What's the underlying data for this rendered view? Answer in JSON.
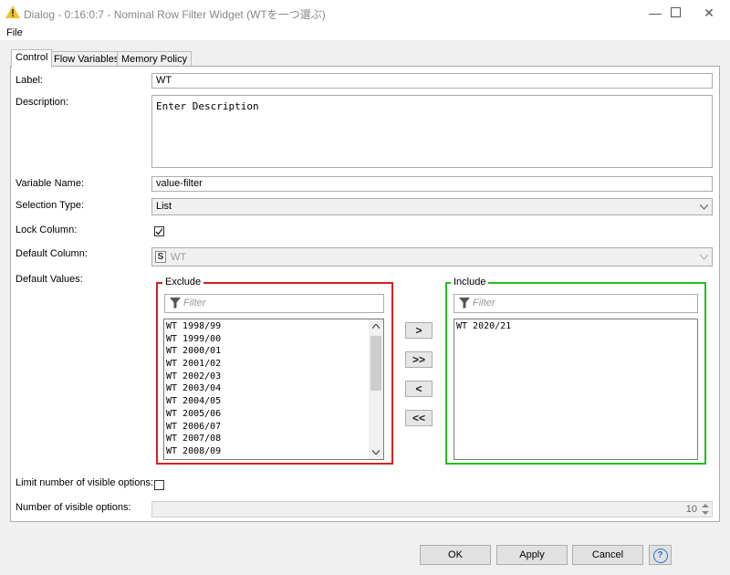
{
  "window": {
    "title": "Dialog - 0:16:0:7 - Nominal Row Filter Widget (WTを一つ選ぶ)"
  },
  "menu": {
    "file": "File"
  },
  "tabs": [
    {
      "label": "Control"
    },
    {
      "label": "Flow Variables"
    },
    {
      "label": "Memory Policy"
    }
  ],
  "form": {
    "label_label": "Label:",
    "label_value": "WT",
    "description_label": "Description:",
    "description_value": "Enter Description",
    "variable_name_label": "Variable Name:",
    "variable_name_value": "value-filter",
    "selection_type_label": "Selection Type:",
    "selection_type_value": "List",
    "lock_column_label": "Lock Column:",
    "lock_column_checked": true,
    "default_column_label": "Default Column:",
    "default_column_type": "S",
    "default_column_value": "WT",
    "default_values_label": "Default Values:",
    "limit_visible_label": "Limit number of visible options:",
    "limit_visible_checked": false,
    "num_visible_label": "Number of visible options:",
    "num_visible_value": "10"
  },
  "exclude": {
    "title": "Exclude",
    "filter_placeholder": "Filter",
    "items": [
      "WT 1998/99",
      "WT 1999/00",
      "WT 2000/01",
      "WT 2001/02",
      "WT 2002/03",
      "WT 2003/04",
      "WT 2004/05",
      "WT 2005/06",
      "WT 2006/07",
      "WT 2007/08",
      "WT 2008/09"
    ]
  },
  "include": {
    "title": "Include",
    "filter_placeholder": "Filter",
    "items": [
      "WT 2020/21"
    ]
  },
  "move_buttons": {
    "add": ">",
    "add_all": ">>",
    "remove": "<",
    "remove_all": "<<"
  },
  "buttons": {
    "ok": "OK",
    "apply": "Apply",
    "cancel": "Cancel",
    "help": "?"
  },
  "colors": {
    "exclude_border": "#d62020",
    "include_border": "#20c020",
    "help_accent": "#1e73d2"
  }
}
